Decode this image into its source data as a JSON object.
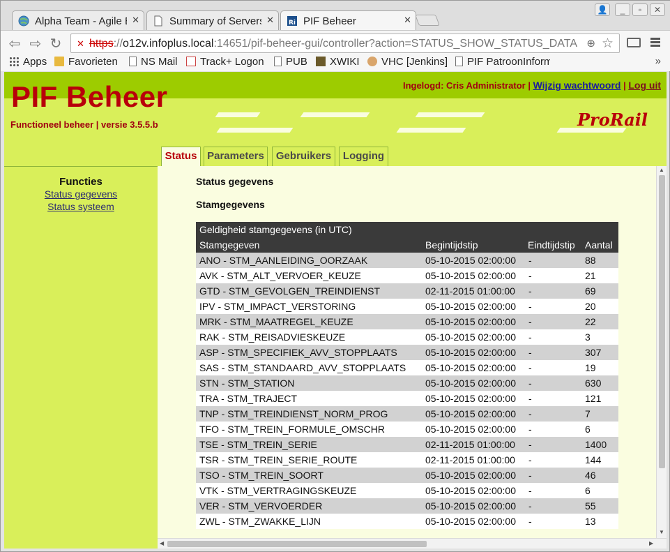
{
  "browser": {
    "tabs": [
      {
        "title": "Alpha Team - Agile B",
        "active": false,
        "favicon": "globe-icon"
      },
      {
        "title": "Summary of Servers",
        "active": false,
        "favicon": "page-icon"
      },
      {
        "title": "PIF Beheer",
        "active": true,
        "favicon": "ri-icon"
      }
    ],
    "url": {
      "scheme": "https",
      "rest_prefix": "://",
      "host": "o12v.infoplus.local",
      "path": ":14651/pif-beheer-gui/controller?action=STATUS_SHOW_STATUS_DATA"
    },
    "bookmarks": [
      {
        "label": "Apps",
        "icon": "apps-grid-icon"
      },
      {
        "label": "Favorieten",
        "icon": "folder-icon"
      },
      {
        "label": "NS Mail",
        "icon": "page-icon"
      },
      {
        "label": "Track+ Logon",
        "icon": "checklist-icon"
      },
      {
        "label": "PUB",
        "icon": "page-icon"
      },
      {
        "label": "XWIKI",
        "icon": "xwiki-icon"
      },
      {
        "label": "VHC [Jenkins]",
        "icon": "jenkins-icon"
      },
      {
        "label": "PIF PatroonInform",
        "icon": "page-icon"
      }
    ],
    "bookmarks_more": "»"
  },
  "page": {
    "app_title": "PIF Beheer",
    "subtitle": "Functioneel beheer | versie 3.5.5.b",
    "logged_in": "Ingelogd: Cris Administrator |",
    "change_password": "Wijzig wachtwoord",
    "separator": "|",
    "logout": "Log uit",
    "logo": "ProRail",
    "nav_tabs": [
      {
        "label": "Status",
        "active": true
      },
      {
        "label": "Parameters",
        "active": false
      },
      {
        "label": "Gebruikers",
        "active": false
      },
      {
        "label": "Logging",
        "active": false
      }
    ],
    "sidebar": {
      "title": "Functies",
      "links": [
        "Status gegevens",
        "Status systeem"
      ]
    },
    "main": {
      "heading": "Status gegevens",
      "subheading": "Stamgegevens",
      "table": {
        "caption": "Geldigheid stamgegevens (in UTC)",
        "columns": [
          "Stamgegeven",
          "Begintijdstip",
          "Eindtijdstip",
          "Aantal"
        ],
        "rows": [
          [
            "ANO - STM_AANLEIDING_OORZAAK",
            "05-10-2015 02:00:00",
            "-",
            "88"
          ],
          [
            "AVK - STM_ALT_VERVOER_KEUZE",
            "05-10-2015 02:00:00",
            "-",
            "21"
          ],
          [
            "GTD - STM_GEVOLGEN_TREINDIENST",
            "02-11-2015 01:00:00",
            "-",
            "69"
          ],
          [
            "IPV - STM_IMPACT_VERSTORING",
            "05-10-2015 02:00:00",
            "-",
            "20"
          ],
          [
            "MRK - STM_MAATREGEL_KEUZE",
            "05-10-2015 02:00:00",
            "-",
            "22"
          ],
          [
            "RAK - STM_REISADVIESKEUZE",
            "05-10-2015 02:00:00",
            "-",
            "3"
          ],
          [
            "ASP - STM_SPECIFIEK_AVV_STOPPLAATS",
            "05-10-2015 02:00:00",
            "-",
            "307"
          ],
          [
            "SAS - STM_STANDAARD_AVV_STOPPLAATS",
            "05-10-2015 02:00:00",
            "-",
            "19"
          ],
          [
            "STN - STM_STATION",
            "05-10-2015 02:00:00",
            "-",
            "630"
          ],
          [
            "TRA - STM_TRAJECT",
            "05-10-2015 02:00:00",
            "-",
            "121"
          ],
          [
            "TNP - STM_TREINDIENST_NORM_PROG",
            "05-10-2015 02:00:00",
            "-",
            "7"
          ],
          [
            "TFO - STM_TREIN_FORMULE_OMSCHR",
            "05-10-2015 02:00:00",
            "-",
            "6"
          ],
          [
            "TSE - STM_TREIN_SERIE",
            "02-11-2015 01:00:00",
            "-",
            "1400"
          ],
          [
            "TSR - STM_TREIN_SERIE_ROUTE",
            "02-11-2015 01:00:00",
            "-",
            "144"
          ],
          [
            "TSO - STM_TREIN_SOORT",
            "05-10-2015 02:00:00",
            "-",
            "46"
          ],
          [
            "VTK - STM_VERTRAGINGSKEUZE",
            "05-10-2015 02:00:00",
            "-",
            "6"
          ],
          [
            "VER - STM_VERVOERDER",
            "05-10-2015 02:00:00",
            "-",
            "55"
          ],
          [
            "ZWL - STM_ZWAKKE_LIJN",
            "05-10-2015 02:00:00",
            "-",
            "13"
          ]
        ]
      }
    }
  },
  "colors": {
    "brand_red": "#b8000a",
    "header_green": "#9dcc00",
    "lime": "#d9ef5a",
    "content_bg": "#fafde0",
    "table_header": "#3a3a3a",
    "row_alt": "#d2d2d2"
  }
}
